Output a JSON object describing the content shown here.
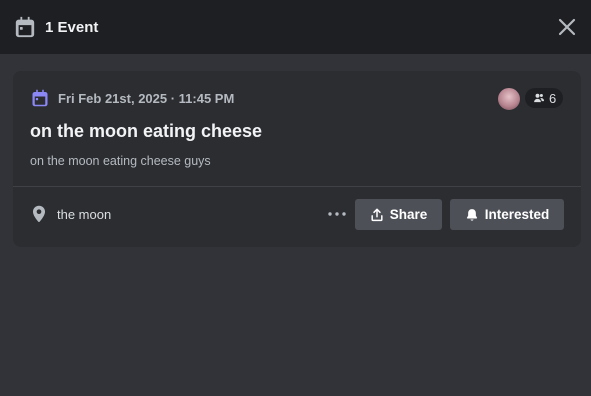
{
  "header": {
    "title": "1 Event",
    "icon": "calendar-icon",
    "close_icon": "close-icon"
  },
  "event": {
    "date": "Fri Feb 21st, 2025 · 11:45 PM",
    "title": "on the moon eating cheese",
    "description": "on the moon eating cheese guys",
    "location": "the moon",
    "attendee_count": "6",
    "icons": {
      "date": "calendar-icon",
      "location": "location-pin-icon",
      "attendees": "people-icon",
      "more": "more-dots-icon",
      "share": "share-icon",
      "interested": "bell-icon"
    }
  },
  "actions": {
    "share_label": "Share",
    "interested_label": "Interested"
  },
  "colors": {
    "header_bg": "#1e1f22",
    "modal_bg": "#313338",
    "card_bg": "#2b2d31",
    "accent": "#8b87f7",
    "button_bg": "#4e5058"
  }
}
